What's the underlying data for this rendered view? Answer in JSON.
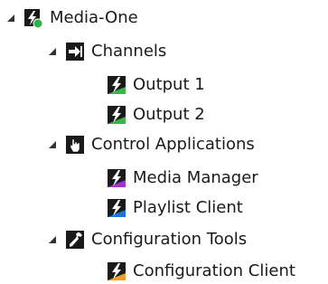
{
  "tree": {
    "root": {
      "label": "Media-One",
      "icon": "media-one-server-icon",
      "expanded": true,
      "status_color": "#2db24a",
      "children": [
        {
          "label": "Channels",
          "icon": "channels-arrow-icon",
          "expanded": true,
          "children": [
            {
              "label": "Output 1",
              "icon": "lightning-output-icon",
              "accent": "#39b54a"
            },
            {
              "label": "Output 2",
              "icon": "lightning-output-icon",
              "accent": "#39b54a"
            }
          ]
        },
        {
          "label": "Control Applications",
          "icon": "hand-pointer-icon",
          "expanded": true,
          "children": [
            {
              "label": "Media Manager",
              "icon": "lightning-media-manager-icon",
              "accent": "#a52fd0"
            },
            {
              "label": "Playlist Client",
              "icon": "lightning-playlist-icon",
              "accent": "#1e73d8"
            }
          ]
        },
        {
          "label": "Configuration Tools",
          "icon": "wrench-icon",
          "expanded": true,
          "children": [
            {
              "label": "Configuration Client",
              "icon": "lightning-config-icon",
              "accent": "#f0a020"
            }
          ]
        }
      ]
    }
  }
}
